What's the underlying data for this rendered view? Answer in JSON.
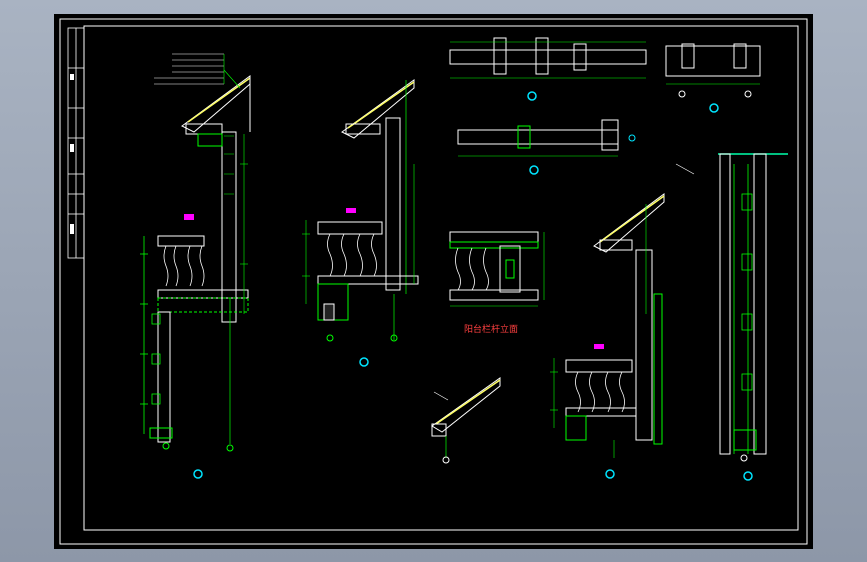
{
  "drawing": {
    "balcony_elevation_title": "阳台栏杆立面"
  },
  "colors": {
    "background": "#000000",
    "frame": "#ffffff",
    "wall": "#ffffff",
    "dimension": "#00ff00",
    "annotation": "#ffffff",
    "section_mark": "#00e5ff",
    "highlight": "#ff00ff",
    "roof_tile": "#ffff66",
    "title_text": "#ff4040"
  }
}
